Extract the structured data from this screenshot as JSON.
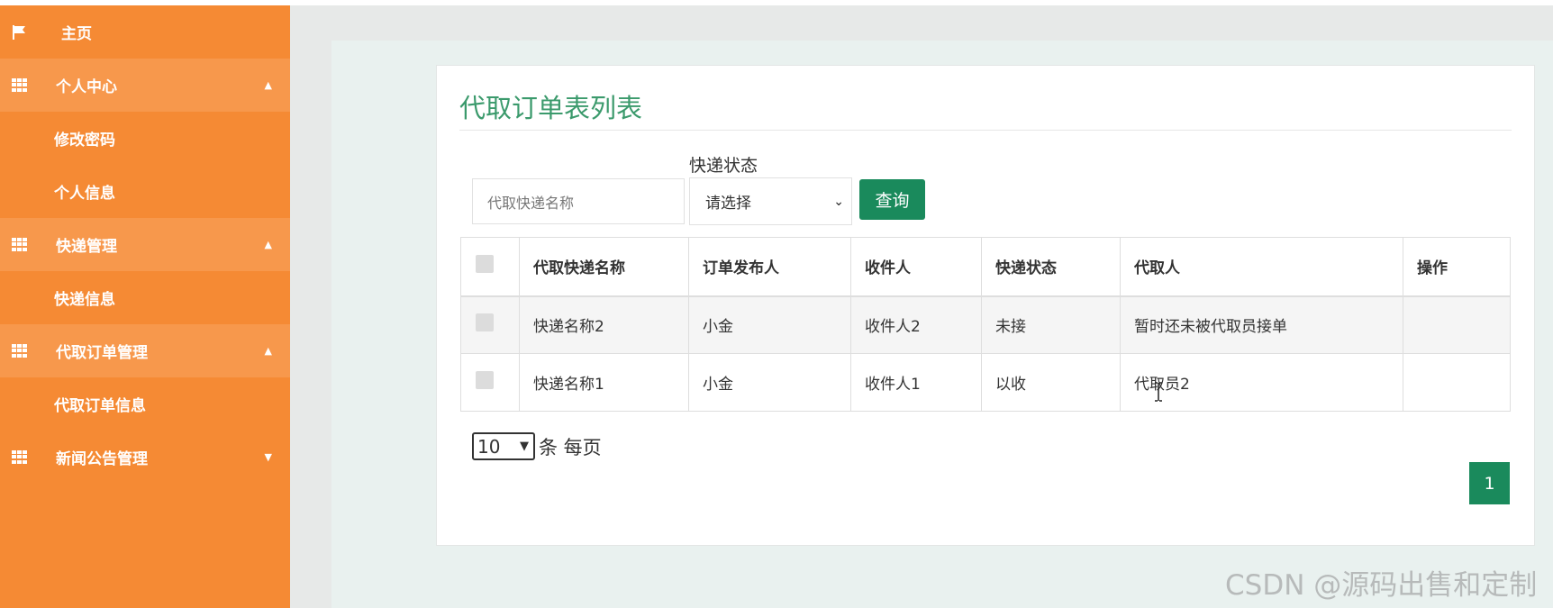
{
  "sidebar": {
    "home": {
      "label": "主页",
      "icon": "flag-icon"
    },
    "groups": [
      {
        "label": "个人中心",
        "icon": "grid-icon",
        "arrow": "up",
        "items": [
          "修改密码",
          "个人信息"
        ]
      },
      {
        "label": "快递管理",
        "icon": "grid-icon",
        "arrow": "up",
        "items": [
          "快递信息"
        ]
      },
      {
        "label": "代取订单管理",
        "icon": "grid-icon",
        "arrow": "up",
        "items": [
          "代取订单信息"
        ]
      },
      {
        "label": "新闻公告管理",
        "icon": "grid-icon",
        "arrow": "down",
        "items": []
      }
    ]
  },
  "page": {
    "title": "代取订单表列表",
    "search": {
      "placeholder": "代取快递名称"
    },
    "status_filter": {
      "label": "快递状态",
      "selected": "请选择"
    },
    "query_label": "查询"
  },
  "table": {
    "headers": [
      "代取快递名称",
      "订单发布人",
      "收件人",
      "快递状态",
      "代取人",
      "操作"
    ],
    "rows": [
      [
        "快递名称2",
        "小金",
        "收件人2",
        "未接",
        "暂时还未被代取员接单",
        ""
      ],
      [
        "快递名称1",
        "小金",
        "收件人1",
        "以收",
        "代取员2",
        ""
      ]
    ]
  },
  "pagination": {
    "page_size": "10",
    "page_size_suffix": "条 每页",
    "current_page": "1"
  },
  "watermark": "CSDN @源码出售和定制",
  "colors": {
    "sidebar": "#f58a34",
    "sidebar_group": "#f7984c",
    "accent": "#1a8a5c",
    "title": "#3b9a6c"
  }
}
